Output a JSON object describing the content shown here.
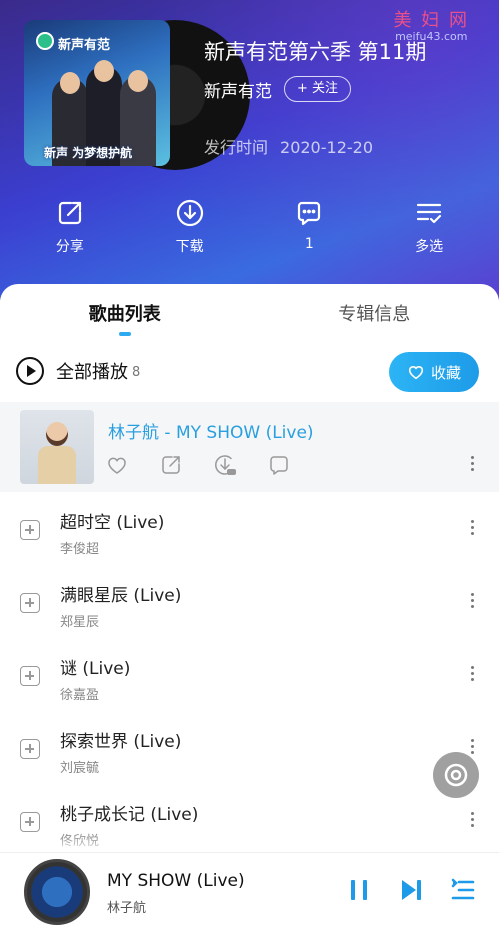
{
  "watermark": {
    "text": "美 妇 网",
    "url": "meifu43.com"
  },
  "album": {
    "title": "新声有范第六季 第11期",
    "artist": "新声有范",
    "follow_label": "+ 关注",
    "release_label": "发行时间",
    "release_date": "2020-12-20",
    "cover_logo": "新声有范",
    "cover_slogan": "新声 为梦想护航"
  },
  "actions": [
    {
      "label": "分享",
      "icon": "share-icon"
    },
    {
      "label": "下载",
      "icon": "download-icon"
    },
    {
      "label": "1",
      "icon": "comment-icon"
    },
    {
      "label": "多选",
      "icon": "multi-select-icon"
    }
  ],
  "tabs": [
    {
      "label": "歌曲列表",
      "active": true
    },
    {
      "label": "专辑信息",
      "active": false
    }
  ],
  "playall": {
    "label": "全部播放",
    "count": "8"
  },
  "collect": {
    "label": "收藏",
    "color": "#2cb4f5"
  },
  "current_song": {
    "title": "林子航 - MY SHOW (Live)",
    "color": "#2a9fe0",
    "icons": [
      "heart-icon",
      "share-icon",
      "vip-download-icon",
      "comment-icon"
    ]
  },
  "songs": [
    {
      "title": "超时空 (Live)",
      "artist": "李俊超"
    },
    {
      "title": "满眼星辰 (Live)",
      "artist": "郑星辰"
    },
    {
      "title": "谜 (Live)",
      "artist": "徐嘉盈"
    },
    {
      "title": "探索世界 (Live)",
      "artist": "刘宸毓"
    },
    {
      "title": "桃子成长记 (Live)",
      "artist": "佟欣悦"
    }
  ],
  "player": {
    "title": "MY SHOW (Live)",
    "artist": "林子航",
    "icons": [
      "pause-icon",
      "next-icon",
      "playlist-icon"
    ]
  }
}
